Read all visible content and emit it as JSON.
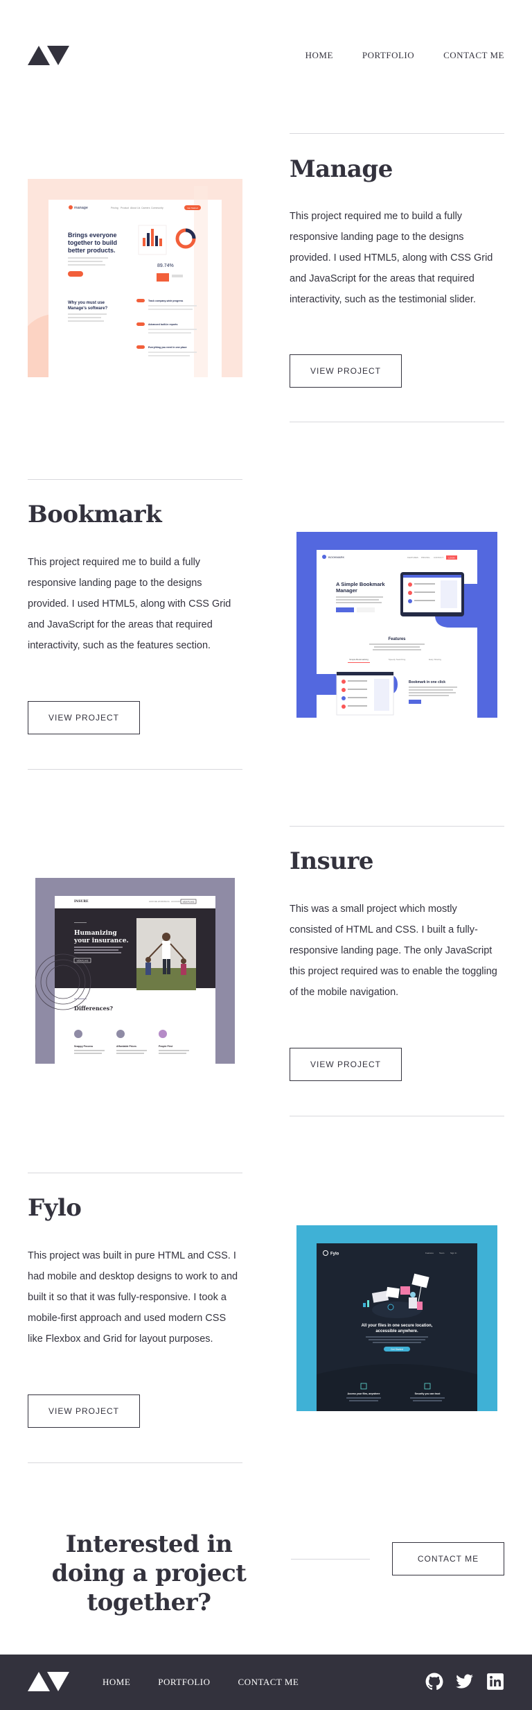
{
  "nav": {
    "home": "HOME",
    "portfolio": "PORTFOLIO",
    "contact": "CONTACT ME"
  },
  "projects": [
    {
      "title": "Manage",
      "description": "This project required me to build a fully responsive landing page to the designs provided. I used HTML5, along with CSS Grid and JavaScript for the areas that required interactivity, such as the testimonial slider.",
      "button": "VIEW PROJECT",
      "thumb": {
        "brand": "manage",
        "nav": [
          "Pricing",
          "Product",
          "About Us",
          "Careers",
          "Community"
        ],
        "cta": "Get Started",
        "headline": "Brings everyone together to build better products.",
        "subhead": "Why you must use Manage's software?",
        "stat": "89.74%",
        "features": [
          "Track company-wide progress",
          "Advanced built-in reports",
          "Everything you need in one place"
        ]
      }
    },
    {
      "title": "Bookmark",
      "description": "This project required me to build a fully responsive landing page to the designs provided. I used HTML5, along with CSS Grid and JavaScript for the areas that required interactivity, such as the features section.",
      "button": "VIEW PROJECT",
      "thumb": {
        "brand": "BOOKMARK",
        "nav": [
          "FEATURES",
          "PRICING",
          "CONTACT",
          "LOGIN"
        ],
        "headline": "A Simple Bookmark Manager",
        "btn1": "Get it on Chrome",
        "btn2": "Get it on Firefox",
        "features_title": "Features",
        "tabs": [
          "Simple Bookmarking",
          "Speedy Searching",
          "Easy Sharing"
        ],
        "panel_title": "Bookmark in one click"
      }
    },
    {
      "title": "Insure",
      "description": "This was a small project which mostly consisted of HTML and CSS. I built a fully-responsive landing page. The only JavaScript this project required was to enable the toggling of the mobile navigation.",
      "button": "VIEW PROJECT",
      "thumb": {
        "brand": "INSURE",
        "nav": [
          "HOW WE WORK",
          "BLOG",
          "ACCOUNT"
        ],
        "nav_cta": "VIEW PLANS",
        "headline": "Humanizing your insurance.",
        "hero_btn": "VIEW PLANS",
        "section": "Differences?",
        "cols": [
          "Snappy Process",
          "Affordable Prices",
          "People First"
        ]
      }
    },
    {
      "title": "Fylo",
      "description": "This project was built in pure HTML and CSS. I had mobile and desktop designs to work to and built it so that it was fully-responsive. I took a mobile-first approach and used modern CSS like Flexbox and Grid for layout purposes.",
      "button": "VIEW PROJECT",
      "thumb": {
        "brand": "Fylo",
        "nav": [
          "Features",
          "Team",
          "Sign In"
        ],
        "headline": "All your files in one secure location, accessible anywhere.",
        "cta": "Get Started",
        "cols": [
          "Access your files, anywhere",
          "Security you can trust"
        ]
      }
    }
  ],
  "cta": {
    "title": "Interested in doing a project together?",
    "button": "CONTACT ME"
  },
  "footer": {
    "nav": {
      "home": "HOME",
      "portfolio": "PORTFOLIO",
      "contact": "CONTACT ME"
    },
    "social": [
      "github-icon",
      "twitter-icon",
      "linkedin-icon"
    ]
  },
  "colors": {
    "text": "#33323d",
    "manage_bg": "#fde5dc",
    "manage_accent": "#f25f3a",
    "bookmark_bg": "#5368df",
    "bookmark_accent": "#fa5757",
    "insure_bg": "#8f8ba5",
    "insure_dark": "#2c2830",
    "fylo_bg": "#3fb1d6",
    "fylo_dark": "#1c2431"
  }
}
